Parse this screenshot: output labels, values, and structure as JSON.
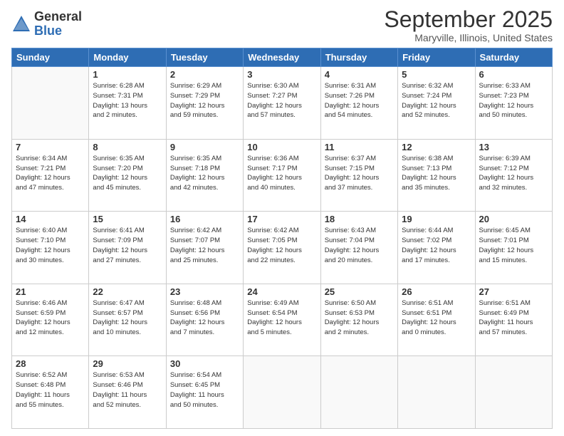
{
  "logo": {
    "general": "General",
    "blue": "Blue"
  },
  "title": "September 2025",
  "location": "Maryville, Illinois, United States",
  "days_header": [
    "Sunday",
    "Monday",
    "Tuesday",
    "Wednesday",
    "Thursday",
    "Friday",
    "Saturday"
  ],
  "weeks": [
    [
      {
        "day": "",
        "info": ""
      },
      {
        "day": "1",
        "info": "Sunrise: 6:28 AM\nSunset: 7:31 PM\nDaylight: 13 hours\nand 2 minutes."
      },
      {
        "day": "2",
        "info": "Sunrise: 6:29 AM\nSunset: 7:29 PM\nDaylight: 12 hours\nand 59 minutes."
      },
      {
        "day": "3",
        "info": "Sunrise: 6:30 AM\nSunset: 7:27 PM\nDaylight: 12 hours\nand 57 minutes."
      },
      {
        "day": "4",
        "info": "Sunrise: 6:31 AM\nSunset: 7:26 PM\nDaylight: 12 hours\nand 54 minutes."
      },
      {
        "day": "5",
        "info": "Sunrise: 6:32 AM\nSunset: 7:24 PM\nDaylight: 12 hours\nand 52 minutes."
      },
      {
        "day": "6",
        "info": "Sunrise: 6:33 AM\nSunset: 7:23 PM\nDaylight: 12 hours\nand 50 minutes."
      }
    ],
    [
      {
        "day": "7",
        "info": "Sunrise: 6:34 AM\nSunset: 7:21 PM\nDaylight: 12 hours\nand 47 minutes."
      },
      {
        "day": "8",
        "info": "Sunrise: 6:35 AM\nSunset: 7:20 PM\nDaylight: 12 hours\nand 45 minutes."
      },
      {
        "day": "9",
        "info": "Sunrise: 6:35 AM\nSunset: 7:18 PM\nDaylight: 12 hours\nand 42 minutes."
      },
      {
        "day": "10",
        "info": "Sunrise: 6:36 AM\nSunset: 7:17 PM\nDaylight: 12 hours\nand 40 minutes."
      },
      {
        "day": "11",
        "info": "Sunrise: 6:37 AM\nSunset: 7:15 PM\nDaylight: 12 hours\nand 37 minutes."
      },
      {
        "day": "12",
        "info": "Sunrise: 6:38 AM\nSunset: 7:13 PM\nDaylight: 12 hours\nand 35 minutes."
      },
      {
        "day": "13",
        "info": "Sunrise: 6:39 AM\nSunset: 7:12 PM\nDaylight: 12 hours\nand 32 minutes."
      }
    ],
    [
      {
        "day": "14",
        "info": "Sunrise: 6:40 AM\nSunset: 7:10 PM\nDaylight: 12 hours\nand 30 minutes."
      },
      {
        "day": "15",
        "info": "Sunrise: 6:41 AM\nSunset: 7:09 PM\nDaylight: 12 hours\nand 27 minutes."
      },
      {
        "day": "16",
        "info": "Sunrise: 6:42 AM\nSunset: 7:07 PM\nDaylight: 12 hours\nand 25 minutes."
      },
      {
        "day": "17",
        "info": "Sunrise: 6:42 AM\nSunset: 7:05 PM\nDaylight: 12 hours\nand 22 minutes."
      },
      {
        "day": "18",
        "info": "Sunrise: 6:43 AM\nSunset: 7:04 PM\nDaylight: 12 hours\nand 20 minutes."
      },
      {
        "day": "19",
        "info": "Sunrise: 6:44 AM\nSunset: 7:02 PM\nDaylight: 12 hours\nand 17 minutes."
      },
      {
        "day": "20",
        "info": "Sunrise: 6:45 AM\nSunset: 7:01 PM\nDaylight: 12 hours\nand 15 minutes."
      }
    ],
    [
      {
        "day": "21",
        "info": "Sunrise: 6:46 AM\nSunset: 6:59 PM\nDaylight: 12 hours\nand 12 minutes."
      },
      {
        "day": "22",
        "info": "Sunrise: 6:47 AM\nSunset: 6:57 PM\nDaylight: 12 hours\nand 10 minutes."
      },
      {
        "day": "23",
        "info": "Sunrise: 6:48 AM\nSunset: 6:56 PM\nDaylight: 12 hours\nand 7 minutes."
      },
      {
        "day": "24",
        "info": "Sunrise: 6:49 AM\nSunset: 6:54 PM\nDaylight: 12 hours\nand 5 minutes."
      },
      {
        "day": "25",
        "info": "Sunrise: 6:50 AM\nSunset: 6:53 PM\nDaylight: 12 hours\nand 2 minutes."
      },
      {
        "day": "26",
        "info": "Sunrise: 6:51 AM\nSunset: 6:51 PM\nDaylight: 12 hours\nand 0 minutes."
      },
      {
        "day": "27",
        "info": "Sunrise: 6:51 AM\nSunset: 6:49 PM\nDaylight: 11 hours\nand 57 minutes."
      }
    ],
    [
      {
        "day": "28",
        "info": "Sunrise: 6:52 AM\nSunset: 6:48 PM\nDaylight: 11 hours\nand 55 minutes."
      },
      {
        "day": "29",
        "info": "Sunrise: 6:53 AM\nSunset: 6:46 PM\nDaylight: 11 hours\nand 52 minutes."
      },
      {
        "day": "30",
        "info": "Sunrise: 6:54 AM\nSunset: 6:45 PM\nDaylight: 11 hours\nand 50 minutes."
      },
      {
        "day": "",
        "info": ""
      },
      {
        "day": "",
        "info": ""
      },
      {
        "day": "",
        "info": ""
      },
      {
        "day": "",
        "info": ""
      }
    ]
  ]
}
